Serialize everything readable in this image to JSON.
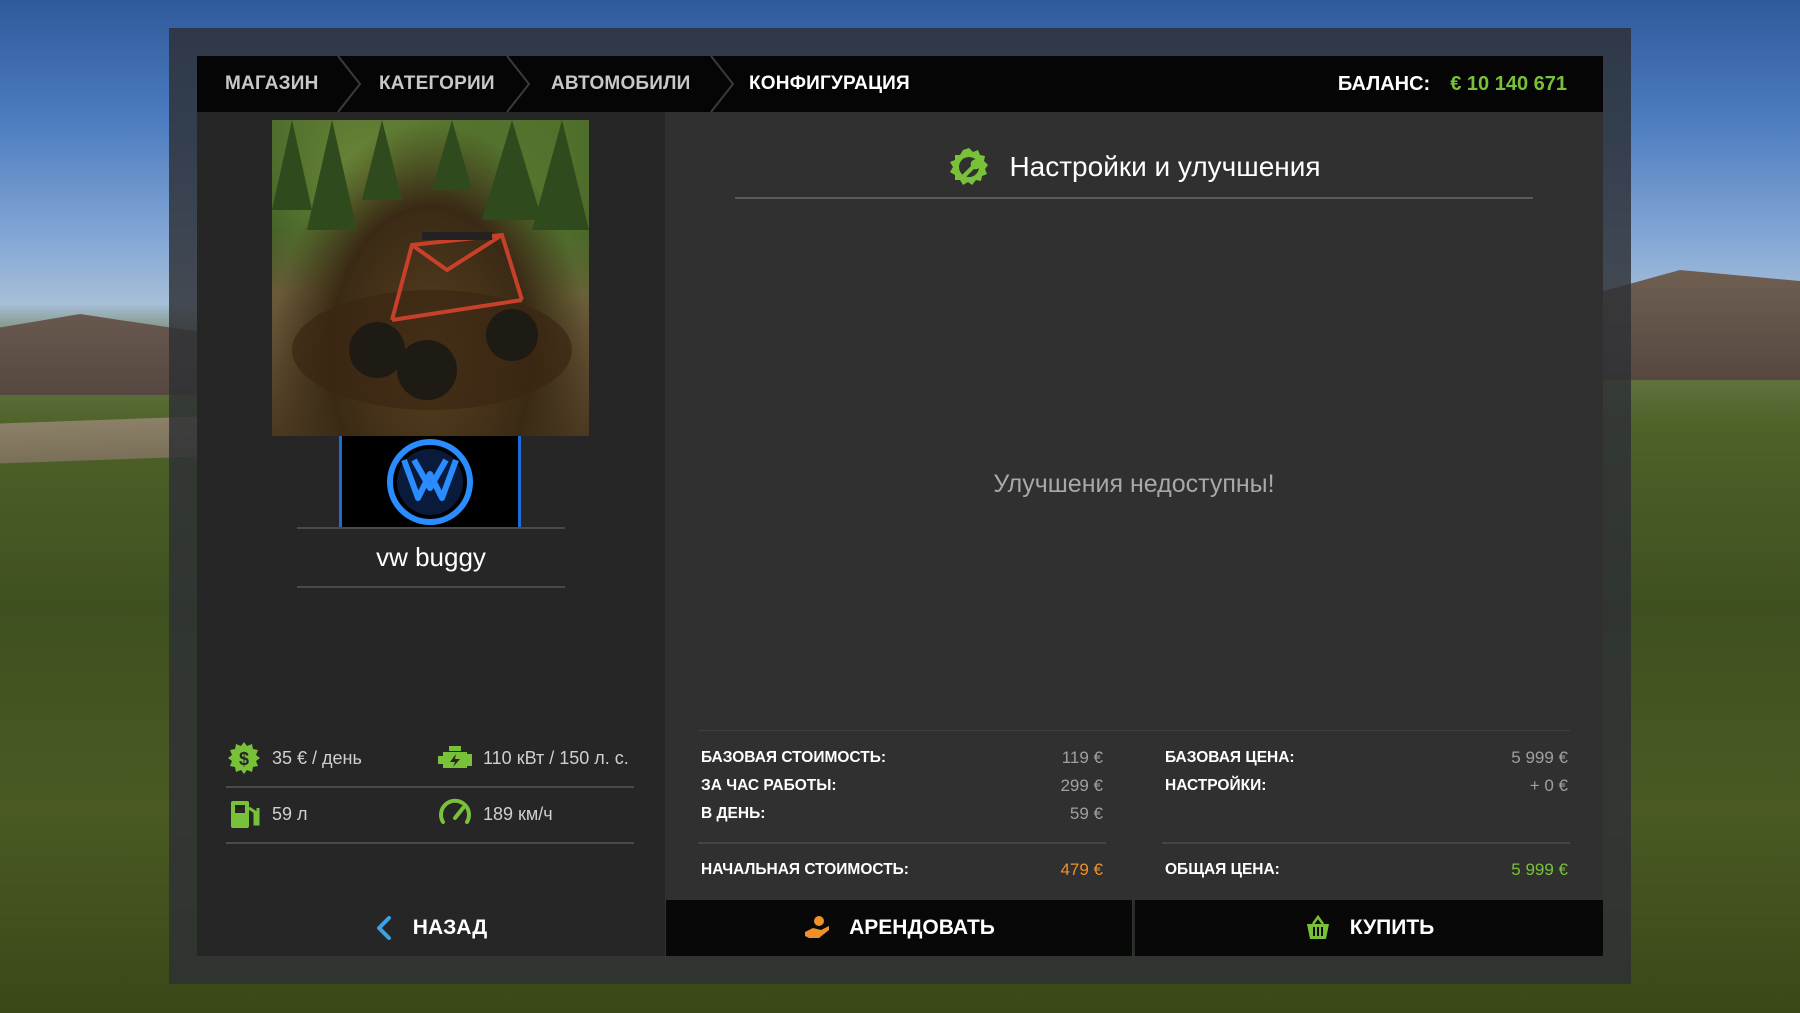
{
  "breadcrumb": {
    "items": [
      {
        "label": "МАГАЗИН"
      },
      {
        "label": "КАТЕГОРИИ"
      },
      {
        "label": "АВТОМОБИЛИ"
      },
      {
        "label": "КОНФИГУРАЦИЯ"
      }
    ]
  },
  "balance": {
    "label": "БАЛАНС:",
    "value": "€ 10 140 671"
  },
  "vehicle": {
    "name": "vw buggy",
    "brand_icon": "vw-logo-icon",
    "image_icon": "vehicle-preview-image"
  },
  "specs": {
    "rent_per_day": "35 € / день",
    "power": "110 кВт / 150 л. с.",
    "fuel": "59 л",
    "speed": "189 км/ч"
  },
  "config": {
    "title": "Настройки и улучшения",
    "empty_message": "Улучшения недоступны!"
  },
  "lease": {
    "base_cost_label": "БАЗОВАЯ СТОИМОСТЬ:",
    "base_cost_value": "119 €",
    "per_hour_label": "ЗА ЧАС РАБОТЫ:",
    "per_hour_value": "299 €",
    "per_day_label": "В ДЕНЬ:",
    "per_day_value": "59 €",
    "initial_label": "НАЧАЛЬНАЯ СТОИМОСТЬ:",
    "initial_value": "479 €"
  },
  "purchase": {
    "base_price_label": "БАЗОВАЯ ЦЕНА:",
    "base_price_value": "5 999 €",
    "config_label": "НАСТРОЙКИ:",
    "config_value": "+ 0 €",
    "total_label": "ОБЩАЯ ЦЕНА:",
    "total_value": "5 999 €"
  },
  "actions": {
    "back": "НАЗАД",
    "lease": "АРЕНДОВАТЬ",
    "buy": "КУПИТЬ"
  },
  "colors": {
    "accent_green": "#7ac13a",
    "accent_orange": "#f0902a",
    "back_blue": "#3ea0e0"
  }
}
